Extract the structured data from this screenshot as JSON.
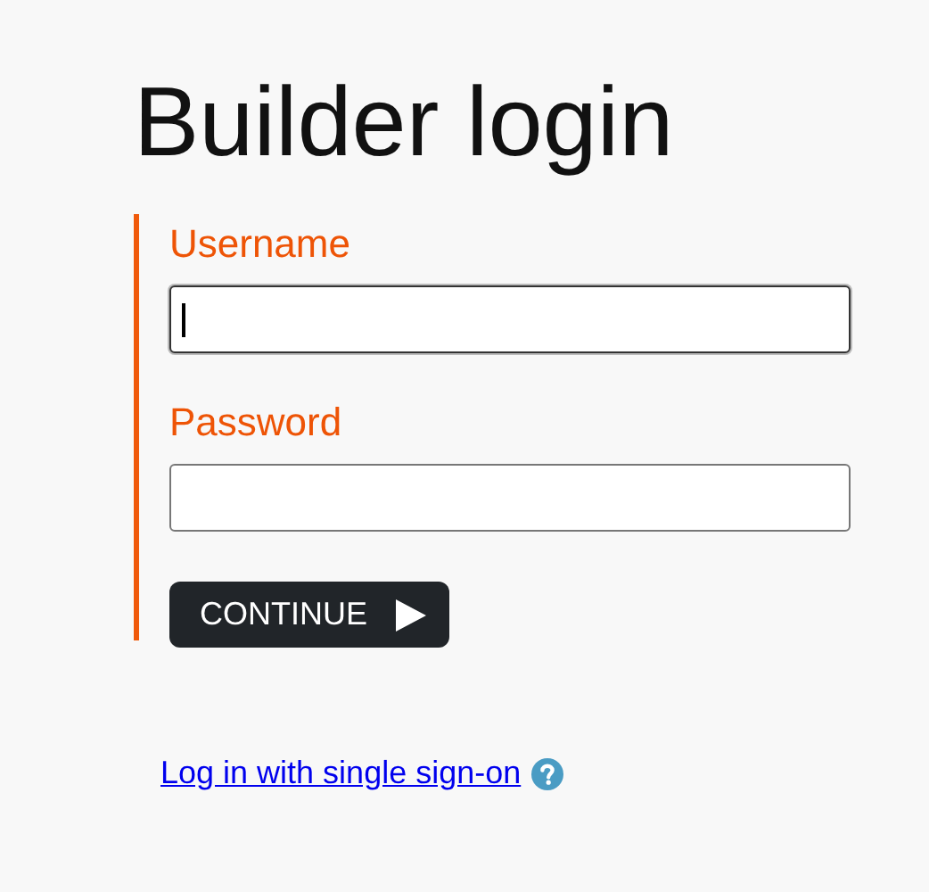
{
  "title": "Builder login",
  "fields": [
    {
      "label": "Username",
      "focused": true
    },
    {
      "label": "Password",
      "focused": false
    }
  ],
  "submit": {
    "label": "CONTINUE"
  },
  "sso_link": {
    "label": "Log in with single sign-on"
  }
}
